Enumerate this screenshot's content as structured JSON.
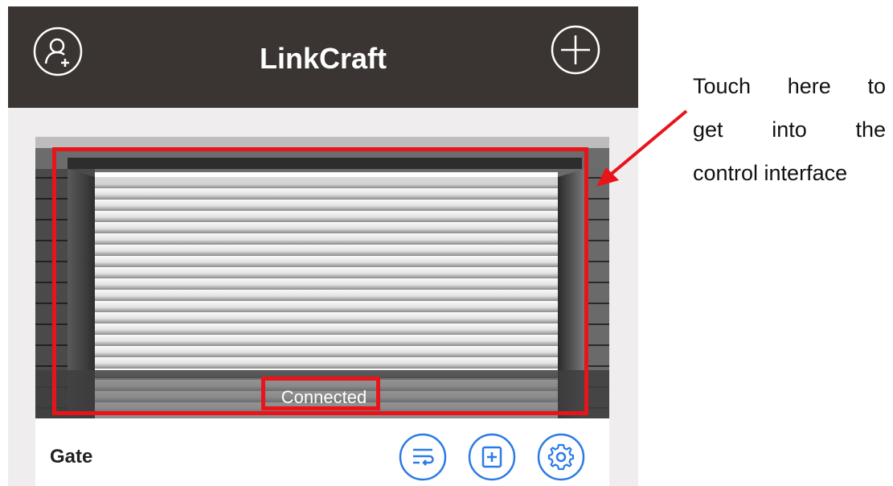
{
  "app": {
    "title": "LinkCraft"
  },
  "header": {
    "left_icon": "add-user-icon",
    "right_icon": "plus-circle-icon"
  },
  "device": {
    "name": "Gate",
    "status": "Connected",
    "image": "roller-shutter-gate-photo",
    "actions": [
      {
        "icon": "wrap-text-icon"
      },
      {
        "icon": "add-folder-icon"
      },
      {
        "icon": "gear-icon"
      }
    ]
  },
  "callout": {
    "lines": [
      [
        "Touch",
        "here",
        "to"
      ],
      [
        "get",
        "into",
        "the"
      ],
      [
        "control interface"
      ]
    ]
  },
  "colors": {
    "header_bg": "#3a3532",
    "highlight": "#e8141a",
    "accent_blue": "#2b7be5"
  }
}
